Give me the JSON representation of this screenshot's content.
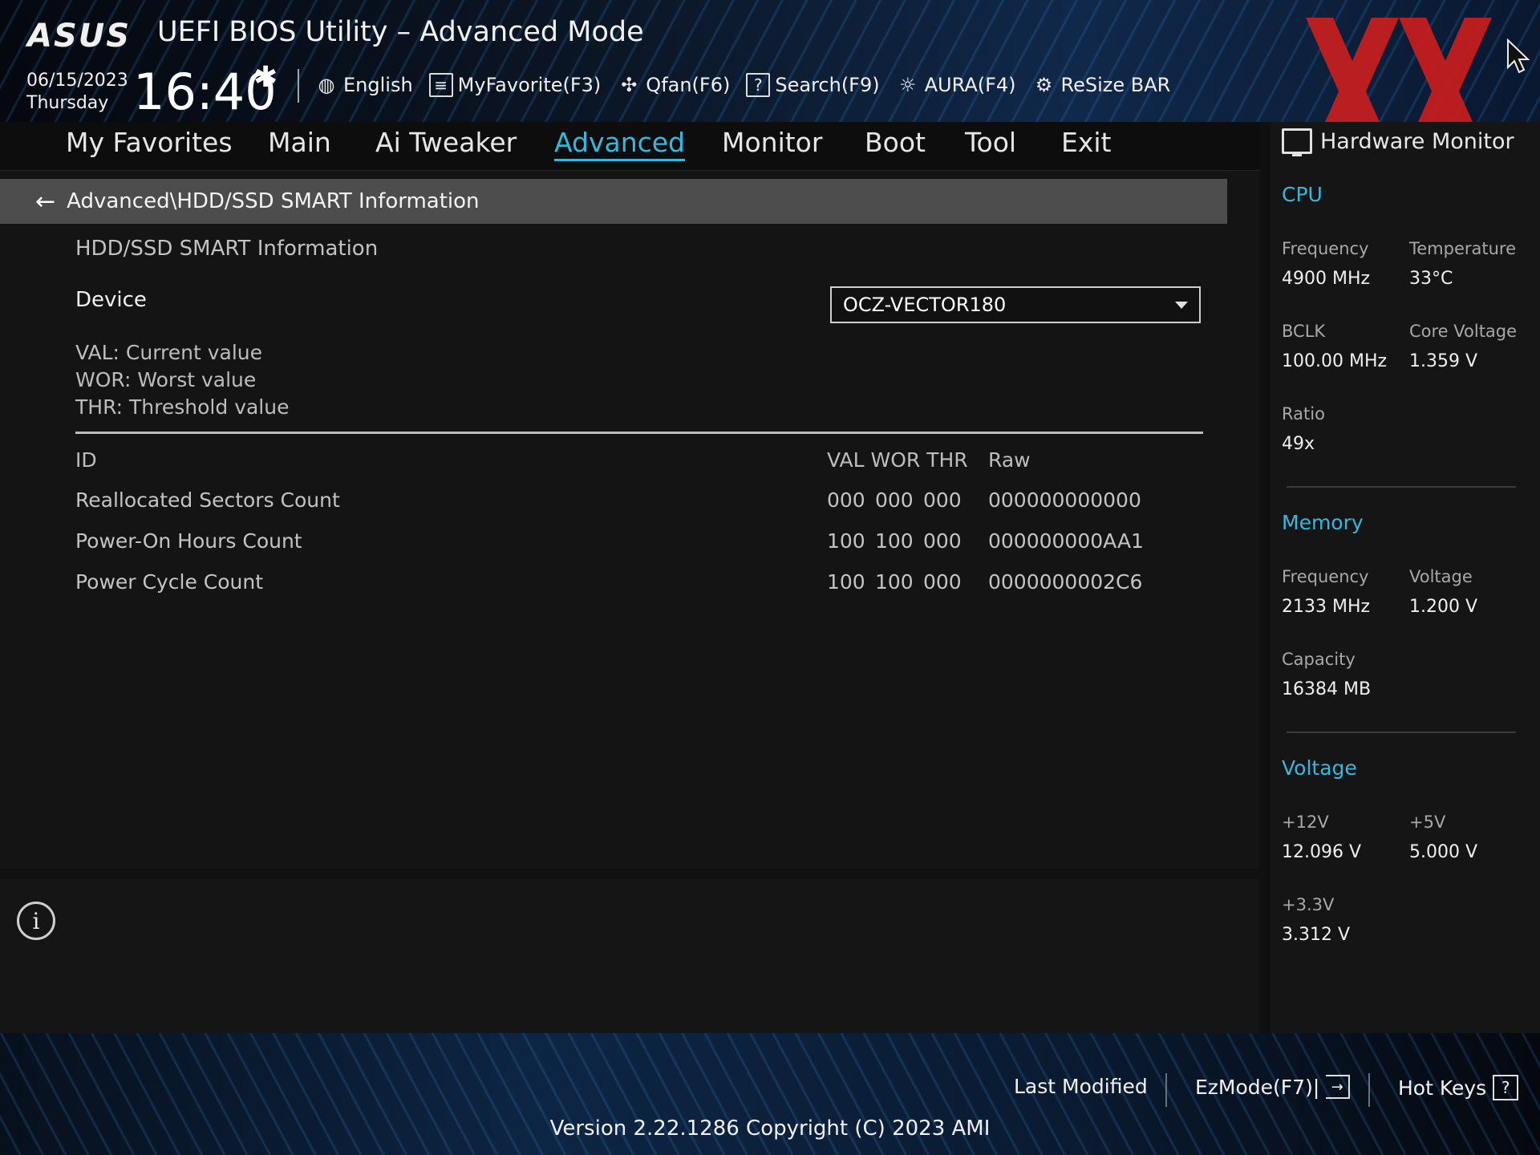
{
  "header": {
    "brand": "ASUS",
    "title": "UEFI BIOS Utility – Advanced Mode",
    "date": "06/15/2023",
    "day": "Thursday",
    "time": "16:40",
    "toolbar": [
      {
        "label": "English",
        "icon": "globe-icon"
      },
      {
        "label": "MyFavorite(F3)",
        "icon": "favorite-list-icon"
      },
      {
        "label": "Qfan(F6)",
        "icon": "fan-icon"
      },
      {
        "label": "Search(F9)",
        "icon": "search-help-icon"
      },
      {
        "label": "AURA(F4)",
        "icon": "aura-light-icon"
      },
      {
        "label": "ReSize BAR",
        "icon": "resize-bar-icon"
      }
    ]
  },
  "nav": {
    "tabs": [
      "My Favorites",
      "Main",
      "Ai Tweaker",
      "Advanced",
      "Monitor",
      "Boot",
      "Tool",
      "Exit"
    ],
    "active": "Advanced"
  },
  "main": {
    "breadcrumb": "Advanced\\HDD/SSD SMART Information",
    "section_title": "HDD/SSD SMART Information",
    "device_label": "Device",
    "device_value": "OCZ-VECTOR180",
    "legend": [
      "VAL:  Current value",
      "WOR: Worst value",
      "THR:  Threshold value"
    ],
    "table": {
      "headers": {
        "id": "ID",
        "val_wor_thr": "VAL WOR THR",
        "raw": "Raw"
      },
      "rows": [
        {
          "id": "Reallocated Sectors Count",
          "val": "000",
          "wor": "000",
          "thr": "000",
          "raw": "000000000000"
        },
        {
          "id": "Power-On Hours Count",
          "val": "100",
          "wor": "100",
          "thr": "000",
          "raw": "000000000AA1"
        },
        {
          "id": "Power Cycle Count",
          "val": "100",
          "wor": "100",
          "thr": "000",
          "raw": "0000000002C6"
        }
      ]
    }
  },
  "hw_monitor": {
    "title": "Hardware Monitor",
    "cpu": {
      "heading": "CPU",
      "frequency_label": "Frequency",
      "frequency": "4900 MHz",
      "temperature_label": "Temperature",
      "temperature": "33°C",
      "bclk_label": "BCLK",
      "bclk": "100.00 MHz",
      "core_voltage_label": "Core Voltage",
      "core_voltage": "1.359 V",
      "ratio_label": "Ratio",
      "ratio": "49x"
    },
    "memory": {
      "heading": "Memory",
      "frequency_label": "Frequency",
      "frequency": "2133 MHz",
      "voltage_label": "Voltage",
      "voltage": "1.200 V",
      "capacity_label": "Capacity",
      "capacity": "16384 MB"
    },
    "voltage": {
      "heading": "Voltage",
      "v12_label": "+12V",
      "v12": "12.096 V",
      "v5_label": "+5V",
      "v5": "5.000 V",
      "v33_label": "+3.3V",
      "v33": "3.312 V"
    }
  },
  "footer": {
    "last_modified": "Last Modified",
    "ezmode": "EzMode(F7)|",
    "hotkeys": "Hot Keys",
    "version": "Version 2.22.1286 Copyright (C) 2023 AMI"
  },
  "colors": {
    "accent": "#35b8e0",
    "watermark": "#c81e1e",
    "breadcrumb_bg": "#4d4d4d"
  }
}
